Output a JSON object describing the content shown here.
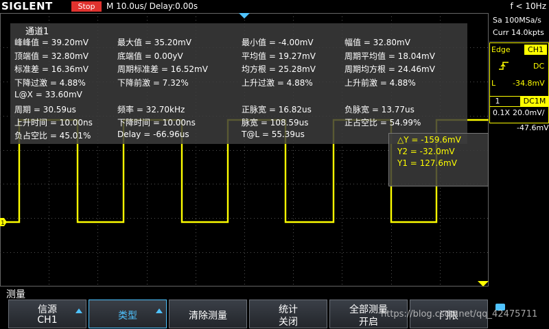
{
  "topbar": {
    "brand": "SIGLENT",
    "run_state": "Stop",
    "timebase": "M 10.0us/  Delay:0.00s",
    "trigger_freq": "f < 10Hz"
  },
  "measurements": {
    "title": "通道1",
    "items": [
      "峰峰值 = 39.20mV",
      "最大值 = 35.20mV",
      "最小值 = -4.00mV",
      "幅值 = 32.80mV",
      "顶端值 = 32.80mV",
      "底端值 = 0.00yV",
      "平均值 = 19.27mV",
      "周期平均值 = 18.04mV",
      "标准差 = 16.36mV",
      "周期标准差 = 16.52mV",
      "均方根 = 25.28mV",
      "周期均方根 = 24.46mV",
      "下降过激 = 4.88%",
      "下降前激 = 7.32%",
      "上升过激 = 4.88%",
      "上升前激 = 4.88%",
      "L@X = 33.60mV",
      "周期 = 30.59us",
      "频率 = 32.70kHz",
      "正脉宽 = 16.82us",
      "负脉宽 = 13.77us",
      "上升时间 = 10.00ns",
      "下降时间 = 10.00ns",
      "脉宽 = 108.59us",
      "正占空比 = 54.99%",
      "负占空比 = 45.01%",
      "Delay = -66.96us",
      "T@L = 55.39us"
    ]
  },
  "cursors": {
    "delta_y": "△Y = -159.6mV",
    "y2": "Y2 = -32.0mV",
    "y1": "Y1 = 127.6mV"
  },
  "side_panel": {
    "sample_rate": "Sa 100MSa/s",
    "curr_points": "Curr 14.0kpts",
    "trigger_type": "Edge",
    "trigger_source": "CH1",
    "trigger_coupling": "DC",
    "trigger_level": "-34.8mV",
    "trigger_level_label": "L",
    "channel_number": "1",
    "channel_coupling": "DC1M",
    "probe": "0.1X",
    "volts_div": "20.0mV/",
    "offset": "-47.6mV"
  },
  "menu": {
    "title": "测量",
    "softkeys": [
      {
        "line1": "信源",
        "line2": "CH1"
      },
      {
        "label": "类型"
      },
      {
        "label": "清除测量"
      },
      {
        "line1": "统计",
        "line2": "关闭"
      },
      {
        "line1": "全部测量",
        "line2": "开启"
      },
      {
        "label": "门限"
      }
    ]
  },
  "watermark": "https://blog.csdn.net/qq_42475711",
  "colors": {
    "trace": "#ffff00",
    "accent": "#4fc3ff",
    "stop": "#e0322e"
  },
  "waveform": {
    "high_level_fraction": 0.39,
    "low_level_fraction": 0.765
  }
}
